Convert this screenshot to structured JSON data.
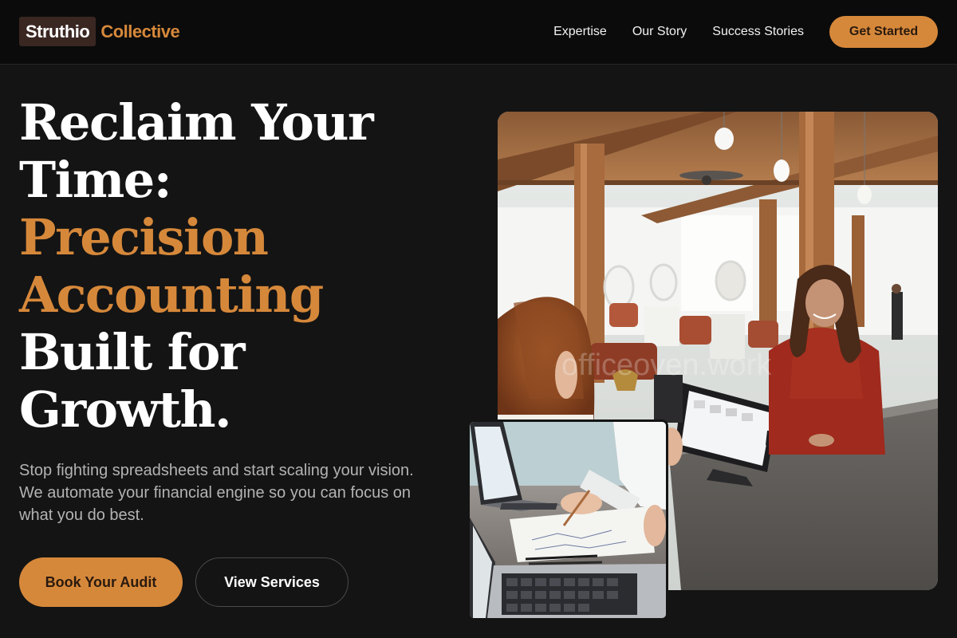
{
  "brand": {
    "name_part1": "Struthio",
    "name_part2": "Collective"
  },
  "nav": {
    "links": [
      "Expertise",
      "Our Story",
      "Success Stories"
    ],
    "cta_label": "Get Started"
  },
  "hero": {
    "title_lines": [
      "Reclaim Your",
      "Time:"
    ],
    "title_accent_lines": [
      "Precision",
      "Accounting"
    ],
    "title_tail_lines": [
      "Built for",
      "Growth."
    ],
    "subtitle": "Stop fighting spreadsheets and start scaling your vision. We automate your financial engine so you can focus on what you do best.",
    "primary_button": "Book Your Audit",
    "secondary_button": "View Services"
  },
  "images": {
    "main_watermark": "officeoven.work"
  },
  "colors": {
    "background": "#141414",
    "nav_background": "#0b0b0b",
    "accent": "#d6883a",
    "logo_box": "#3a2722",
    "muted_text": "#b3b3b3"
  }
}
